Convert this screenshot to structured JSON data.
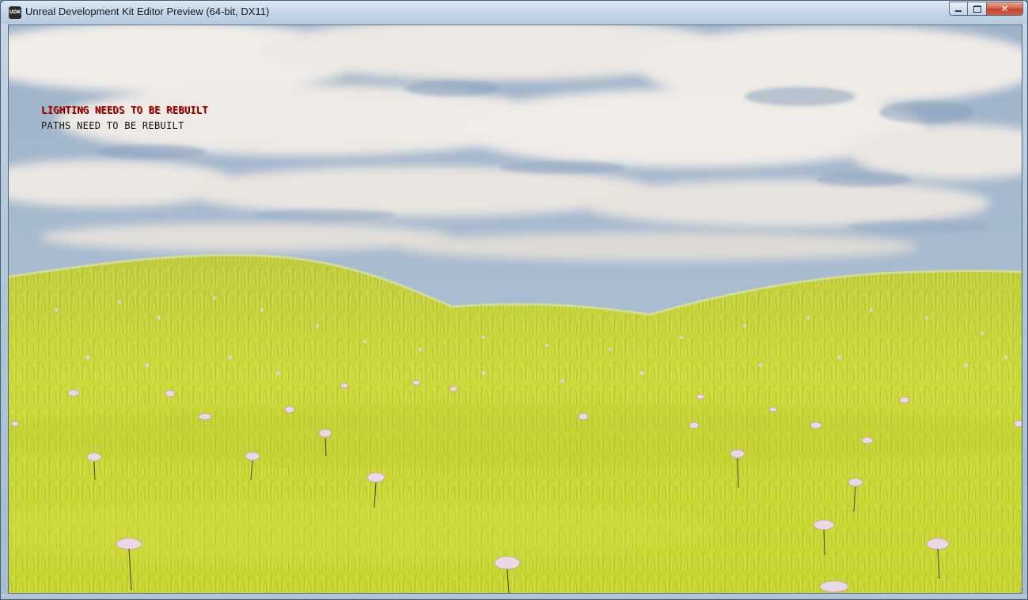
{
  "window": {
    "title": "Unreal Development Kit Editor Preview (64-bit, DX11)",
    "app_icon": "udk-logo-icon",
    "controls": {
      "minimize_icon": "minimize-icon",
      "maximize_icon": "maximize-icon",
      "close_icon": "close-icon",
      "close_glyph": "✕"
    }
  },
  "hud": {
    "lighting_warning": "LIGHTING NEEDS TO BE REBUILT",
    "paths_warning": "PATHS NEED TO BE REBUILT",
    "lighting_color": "#e00000",
    "paths_color": "#111111"
  },
  "scene": {
    "description_colors": {
      "sky": "#8fa8c2",
      "cloud": "#eeeae4",
      "grass": "#c9d437",
      "grass_shadow": "#9aa81e",
      "flower": "#e9d6e4"
    }
  }
}
